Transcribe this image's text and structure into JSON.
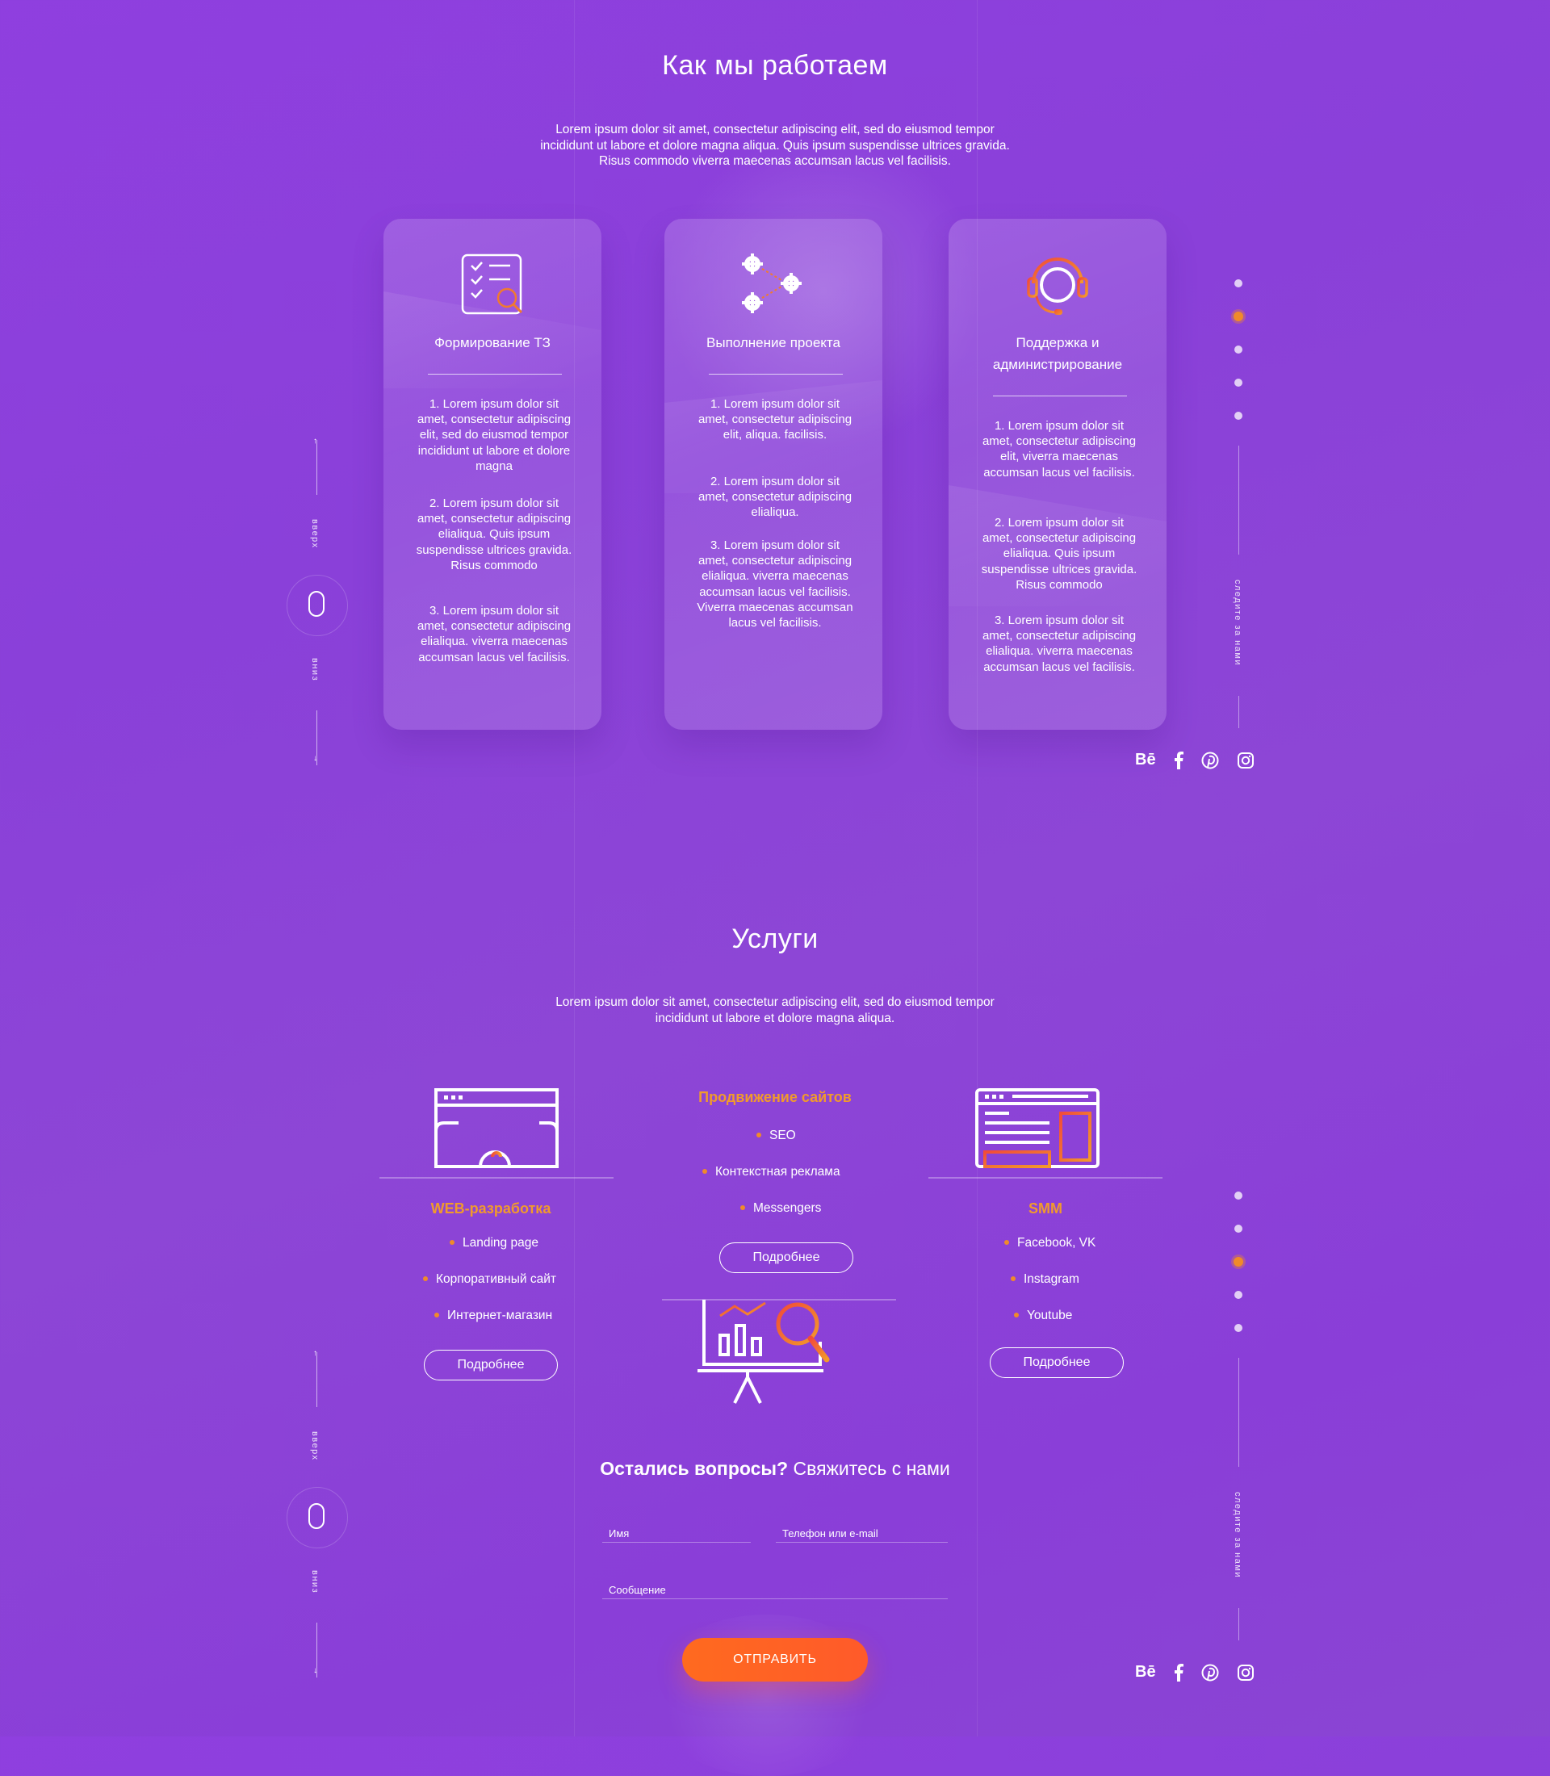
{
  "how": {
    "title": "Как мы работаем",
    "lead": [
      "Lorem ipsum dolor sit amet, consectetur adipiscing elit, sed do eiusmod tempor",
      "incididunt ut labore et dolore magna aliqua. Quis ipsum suspendisse ultrices gravida.",
      "Risus commodo viverra maecenas accumsan lacus vel facilisis."
    ],
    "cards": [
      {
        "title_lines": [
          "Формирование ТЗ"
        ],
        "icon": "checklist-search-icon",
        "items": [
          "1. Lorem ipsum dolor sit amet, consectetur adipiscing elit, sed do eiusmod tempor incididunt ut labore et dolore magna",
          "2. Lorem ipsum dolor sit amet, consectetur adipiscing elialiqua. Quis ipsum suspendisse ultrices gravida. Risus commodo",
          "3. Lorem ipsum dolor sit amet, consectetur adipiscing elialiqua. viverra maecenas accumsan lacus vel facilisis."
        ]
      },
      {
        "title_lines": [
          "Выполнение проекта"
        ],
        "icon": "gears-icon",
        "items": [
          "1. Lorem ipsum dolor sit amet, consectetur adipiscing elit, aliqua. facilisis.",
          "2. Lorem ipsum dolor sit amet, consectetur adipiscing elialiqua.",
          "3. Lorem ipsum dolor sit amet, consectetur adipiscing elialiqua. viverra maecenas accumsan lacus vel facilisis. Viverra maecenas accumsan lacus vel facilisis."
        ]
      },
      {
        "title_lines": [
          "Поддержка и",
          "администрирование"
        ],
        "icon": "headset-icon",
        "items": [
          "1. Lorem ipsum dolor sit amet, consectetur adipiscing elit, viverra maecenas accumsan lacus vel facilisis.",
          "2. Lorem ipsum dolor sit amet, consectetur adipiscing elialiqua. Quis ipsum suspendisse ultrices gravida. Risus commodo",
          "3. Lorem ipsum dolor sit amet, consectetur adipiscing elialiqua. viverra maecenas accumsan lacus vel facilisis."
        ]
      }
    ]
  },
  "nav": {
    "up": "вверх",
    "down": "вниз",
    "follow": "следите за нами"
  },
  "social": [
    "behance-icon",
    "facebook-icon",
    "pinterest-icon",
    "instagram-icon"
  ],
  "services": {
    "title": "Услуги",
    "lead": [
      "Lorem ipsum dolor sit amet, consectetur adipiscing elit, sed do eiusmod tempor",
      "incididunt ut labore et dolore magna aliqua."
    ],
    "web": {
      "title": "WEB-разработка",
      "items": [
        "Landing page",
        "Корпоративный сайт",
        "Интернет-магазин"
      ],
      "button": "Подробнее"
    },
    "seo": {
      "title": "Продвижение сайтов",
      "items": [
        "SEO",
        "Контекстная реклама",
        "Messengers"
      ],
      "button": "Подробнее"
    },
    "smm": {
      "title": "SMM",
      "items": [
        "Facebook, VK",
        "Instagram",
        "Youtube"
      ],
      "button": "Подробнее"
    }
  },
  "contact": {
    "title_bold": "Остались вопросы?",
    "title_rest": " Свяжитесь с нами",
    "name_label": "Имя",
    "phone_label": "Телефон или e-mail",
    "message_label": "Сообщение",
    "send": "ОТПРАВИТЬ"
  },
  "colors": {
    "accent": "#f08a2a",
    "button": "#ff6a1f",
    "background": "#8a40d9"
  }
}
